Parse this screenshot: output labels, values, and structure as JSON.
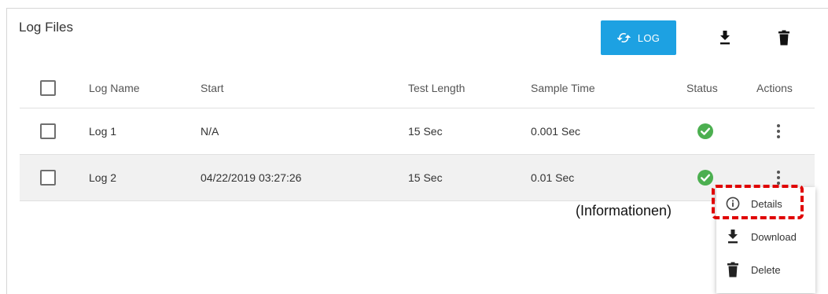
{
  "header": {
    "title": "Log Files",
    "refresh_log_label": "LOG"
  },
  "table": {
    "columns": [
      "Log Name",
      "Start",
      "Test Length",
      "Sample Time",
      "Status",
      "Actions"
    ],
    "rows": [
      {
        "name": "Log 1",
        "start": "N/A",
        "test_length": "15 Sec",
        "sample_time": "0.001 Sec",
        "status": "ok"
      },
      {
        "name": "Log 2",
        "start": "04/22/2019 03:27:26",
        "test_length": "15 Sec",
        "sample_time": "0.01 Sec",
        "status": "ok"
      }
    ]
  },
  "actions_menu": {
    "items": [
      {
        "label": "Details",
        "icon": "info-icon"
      },
      {
        "label": "Download",
        "icon": "download-icon"
      },
      {
        "label": "Delete",
        "icon": "trash-icon"
      }
    ]
  },
  "annotation": {
    "callout": "(Informationen)",
    "highlight_color": "#e00000"
  },
  "colors": {
    "accent": "#1da1e2",
    "status_ok": "#4caf50",
    "row_selected_bg": "#f1f1f1"
  }
}
